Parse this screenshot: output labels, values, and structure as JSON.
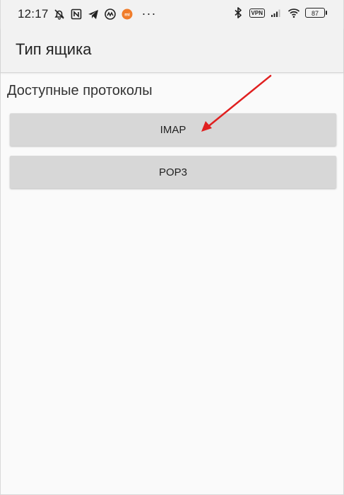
{
  "status_bar": {
    "time": "12:17",
    "notification_icons": [
      "mute-bell-icon",
      "nfc-icon",
      "telegram-icon",
      "app-icon",
      "mi-icon",
      "more-dots-icon"
    ],
    "right_icons": [
      "bluetooth-icon",
      "vpn-icon",
      "signal-icon",
      "wifi-icon",
      "battery-icon"
    ],
    "vpn_label": "VPN",
    "battery_level": "87",
    "more_dots": "···",
    "mi_label": "mi"
  },
  "app_bar": {
    "title": "Тип ящика"
  },
  "main": {
    "section_label": "Доступные протоколы",
    "protocols": [
      {
        "label": "IMAP"
      },
      {
        "label": "POP3"
      }
    ]
  },
  "annotation": {
    "arrow_color": "#e02020",
    "points_to": "IMAP"
  }
}
